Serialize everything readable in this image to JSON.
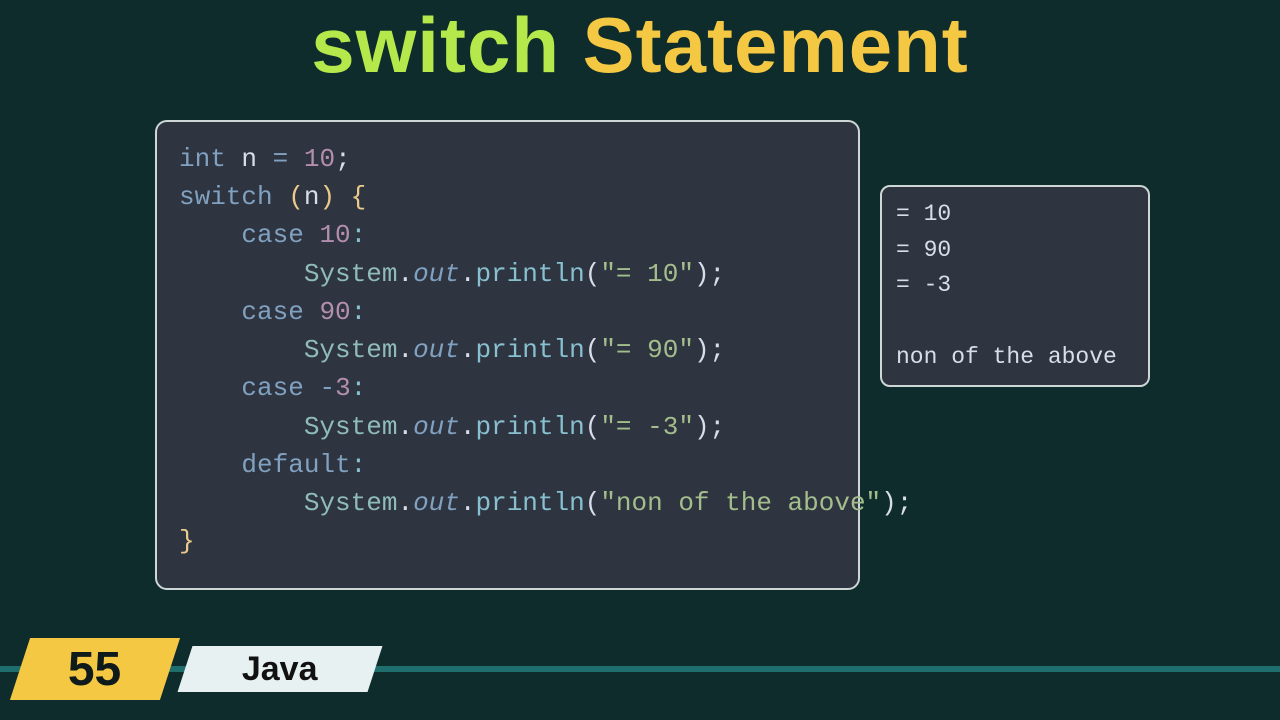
{
  "title": {
    "keyword": "switch",
    "rest": " Statement"
  },
  "code": {
    "decl": {
      "kw": "int",
      "id": "n",
      "eq": "=",
      "num": "10",
      "semi": ";"
    },
    "switch": {
      "kw": "switch",
      "lp": "(",
      "id": "n",
      "rp": ")",
      "lb": "{"
    },
    "cases": [
      {
        "kw": "case",
        "val": "10",
        "colon": ":",
        "str": "\"= 10\""
      },
      {
        "kw": "case",
        "val": "90",
        "colon": ":",
        "str": "\"= 90\""
      },
      {
        "kw": "case",
        "val": "-3",
        "colon": ":",
        "str": "\"= -3\""
      }
    ],
    "default": {
      "kw": "default",
      "colon": ":",
      "str": "\"non of the above\""
    },
    "sys": "System",
    "out": "out",
    "meth": "println",
    "rb": "}"
  },
  "output": {
    "lines": [
      "= 10",
      "= 90",
      "= -3",
      "",
      "non of the above"
    ]
  },
  "footer": {
    "number": "55",
    "lang": "Java"
  }
}
